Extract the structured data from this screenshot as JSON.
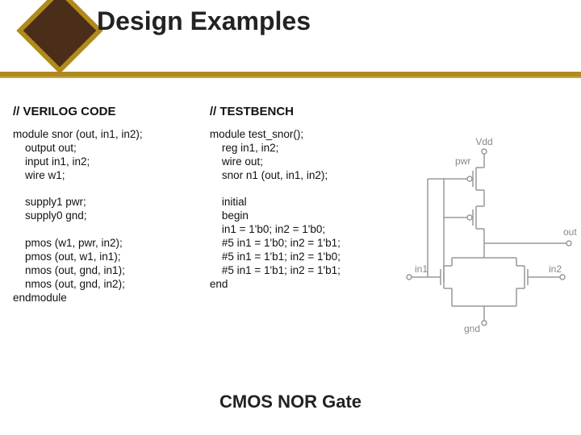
{
  "title": "Design Examples",
  "footer": "CMOS NOR Gate",
  "col1": {
    "header": "// VERILOG CODE",
    "code": "module snor (out, in1, in2);\n    output out;\n    input in1, in2;\n    wire w1;\n\n    supply1 pwr;\n    supply0 gnd;\n\n    pmos (w1, pwr, in2);\n    pmos (out, w1, in1);\n    nmos (out, gnd, in1);\n    nmos (out, gnd, in2);\nendmodule"
  },
  "col2": {
    "header": "// TESTBENCH",
    "code": "module test_snor();\n    reg in1, in2;\n    wire out;\n    snor n1 (out, in1, in2);\n\n    initial\n    begin\n    in1 = 1'b0; in2 = 1'b0;\n    #5 in1 = 1'b0; in2 = 1'b1;\n    #5 in1 = 1'b1; in2 = 1'b0;\n    #5 in1 = 1'b1; in2 = 1'b1;\nend"
  },
  "circuit": {
    "labels": {
      "vdd": "Vdd",
      "pwr": "pwr",
      "out": "out",
      "in1": "in1",
      "in2": "in2",
      "gnd": "gnd"
    }
  }
}
